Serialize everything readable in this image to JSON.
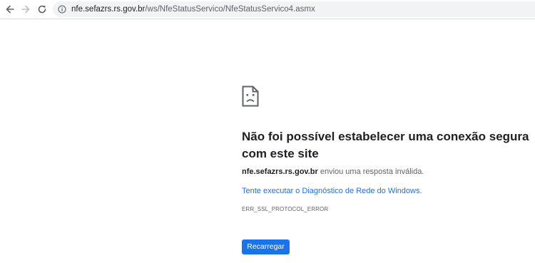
{
  "browser": {
    "url_host": "nfe.sefazrs.rs.gov.br",
    "url_path": "/ws/NfeStatusServico/NfeStatusServico4.asmx",
    "icons": {
      "back": "back-arrow-icon",
      "forward": "forward-arrow-icon",
      "reload": "reload-icon",
      "site_info": "info-icon"
    }
  },
  "error_page": {
    "icon": "sad-document-icon",
    "title": "Não foi possível estabelecer uma conexão segura com este site",
    "host": "nfe.sefazrs.rs.gov.br",
    "description_suffix": " enviou uma resposta inválida.",
    "diagnostics_link": "Tente executar o Diagnóstico de Rede do Windows.",
    "error_code": "ERR_SSL_PROTOCOL_ERROR",
    "reload_label": "Recarregar"
  },
  "colors": {
    "accent": "#1a73e8",
    "title": "#202124",
    "secondary_text": "#5f6368",
    "omnibox_bg": "#f1f3f4"
  }
}
